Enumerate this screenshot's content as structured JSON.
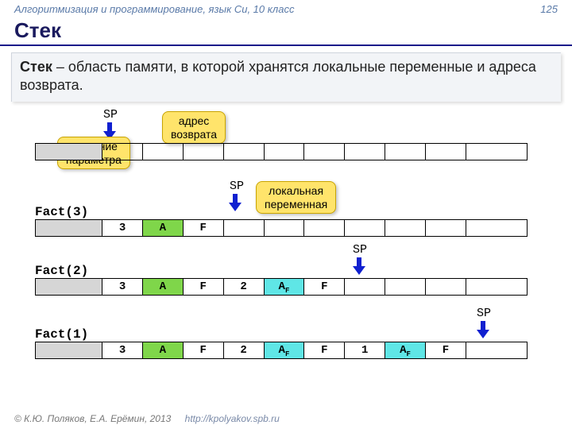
{
  "header": {
    "course": "Алгоритмизация и программирование, язык Си, 10 класс",
    "page": "125"
  },
  "title": "Стек",
  "definition": {
    "term": "Стек",
    "rest": " – область памяти, в которой хранятся локальные переменные и адреса возврата."
  },
  "sp": "SP",
  "callouts": {
    "param": "значение\nпараметра",
    "return": "адрес\nвозврата",
    "local": "локальная\nпеременная"
  },
  "rows": {
    "r1": {
      "label": "Fact(3)",
      "c2": "3",
      "c3": "A",
      "c4": "F"
    },
    "r2": {
      "label": "Fact(2)",
      "c2": "3",
      "c3": "A",
      "c4": "F",
      "c5": "2",
      "c6": "A",
      "c6s": "F",
      "c7": "F"
    },
    "r3": {
      "label": "Fact(1)",
      "c2": "3",
      "c3": "A",
      "c4": "F",
      "c5": "2",
      "c6": "A",
      "c6s": "F",
      "c7": "F",
      "c8": "1",
      "c9": "A",
      "c9s": "F",
      "c10": "F"
    }
  },
  "footer": {
    "copy": "© К.Ю. Поляков, Е.А. Ерёмин, 2013",
    "url": "http://kpolyakov.spb.ru"
  }
}
